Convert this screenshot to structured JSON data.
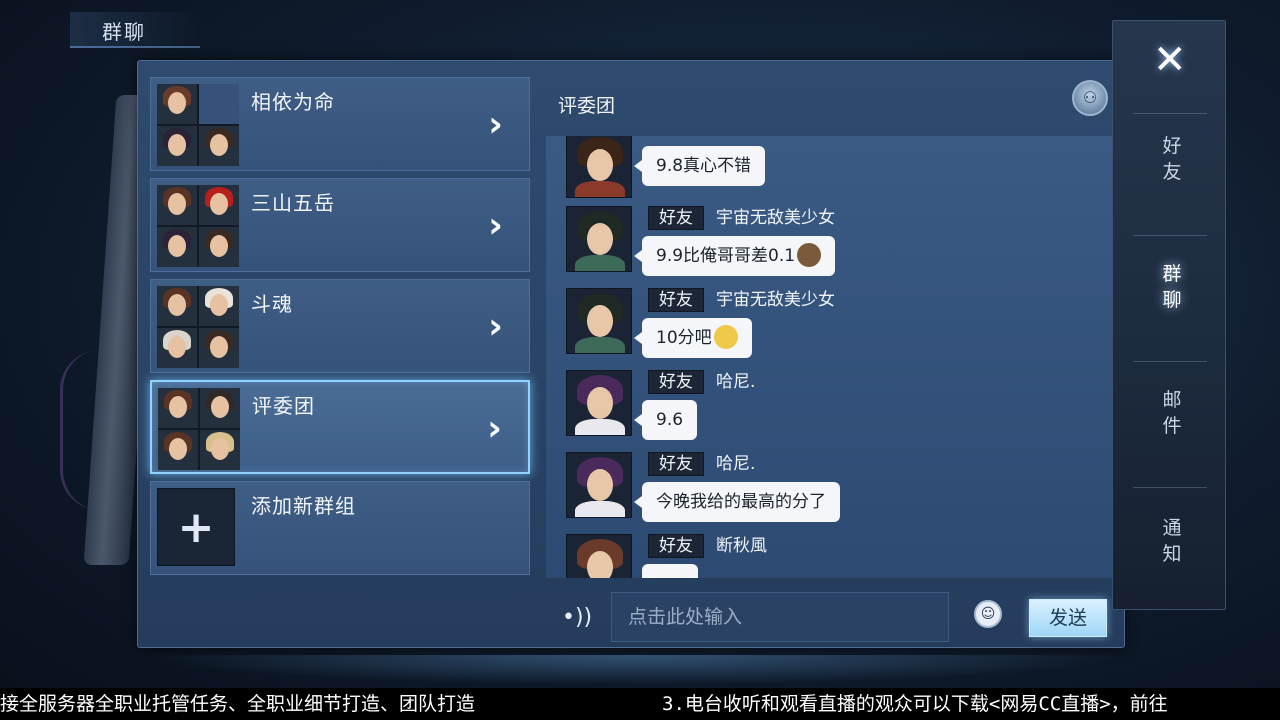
{
  "window": {
    "title": "群聊"
  },
  "groups": [
    {
      "name": "相依为命",
      "selected": false,
      "avatars": [
        "#6b3b2a",
        "#2b2238",
        "#3a2a24"
      ]
    },
    {
      "name": "三山五岳",
      "selected": false,
      "avatars": [
        "#5a3324",
        "#b8201e",
        "#2b2238",
        "#3a2a24"
      ]
    },
    {
      "name": "斗魂",
      "selected": false,
      "avatars": [
        "#5a3324",
        "#e8e4dc",
        "#d9d4cc",
        "#3a2a24"
      ]
    },
    {
      "name": "评委团",
      "selected": true,
      "avatars": [
        "#5a3324",
        "#2f2a28",
        "#5a3324",
        "#d8c08a"
      ]
    }
  ],
  "add_group": {
    "label": "添加新群组",
    "icon": "plus-icon"
  },
  "chat": {
    "title": "评委团",
    "messages": [
      {
        "tag": "",
        "sender": "",
        "text": "9.8真心不错",
        "avatar_hair": "#3b2418",
        "avatar_robe": "#8b3a2a"
      },
      {
        "tag": "好友",
        "sender": "宇宙无敌美少女",
        "text": "9.9比俺哥哥差0.1",
        "emoji": "#7a5a3a",
        "avatar_hair": "#202a24",
        "avatar_robe": "#3e6a5a"
      },
      {
        "tag": "好友",
        "sender": "宇宙无敌美少女",
        "text": "10分吧",
        "emoji": "#f0c84a",
        "avatar_hair": "#202a24",
        "avatar_robe": "#3e6a5a"
      },
      {
        "tag": "好友",
        "sender": "哈尼.",
        "text": "9.6",
        "avatar_hair": "#4a2a5a",
        "avatar_robe": "#e8e8ee"
      },
      {
        "tag": "好友",
        "sender": "哈尼.",
        "text": "今晚我给的最高的分了",
        "avatar_hair": "#4a2a5a",
        "avatar_robe": "#e8e8ee"
      },
      {
        "tag": "好友",
        "sender": "断秋風",
        "text": "",
        "avatar_hair": "#6a3a2a",
        "avatar_robe": "#8b4a3a"
      }
    ],
    "input_placeholder": "点击此处输入",
    "send_label": "发送"
  },
  "sidebar": {
    "tabs": [
      {
        "label": "好\n友",
        "active": false
      },
      {
        "label": "群\n聊",
        "active": true
      },
      {
        "label": "邮\n件",
        "active": false
      },
      {
        "label": "通\n知",
        "active": false
      }
    ]
  },
  "ticker": {
    "left": "接全服务器全职业托管任务、全职业细节打造、团队打造",
    "right": "3.电台收听和观看直播的观众可以下载<网易CC直播>，前往"
  },
  "colors": {
    "panel": "#2e4a6e",
    "highlight": "#8fd3ff",
    "send_button": "#9fd6f6"
  }
}
